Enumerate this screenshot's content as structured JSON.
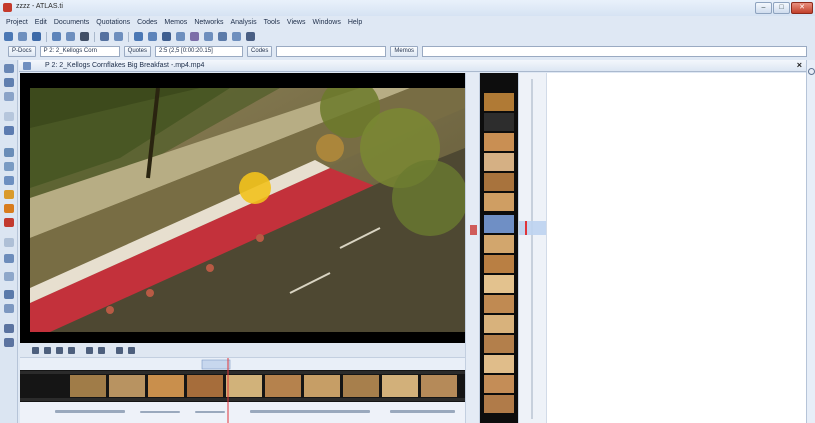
{
  "window": {
    "title": "zzzz - ATLAS.ti"
  },
  "menu": [
    "Project",
    "Edit",
    "Documents",
    "Quotations",
    "Codes",
    "Memos",
    "Networks",
    "Analysis",
    "Tools",
    "Views",
    "Windows",
    "Help"
  ],
  "docbar": {
    "docs_label": "P-Docs",
    "doc_value": "P 2: 2_Kellogs Corn",
    "quotes_label": "Quotes",
    "quote_value": "2:5 (2,5 [0:00:20.15]",
    "codes_label": "Codes",
    "memos_label": "Memos"
  },
  "document": {
    "title": "P 2: 2_Kellogs Cornflakes  Big Breakfast -.mp4.mp4"
  },
  "colors": {
    "accent": "#c43a2c",
    "chrome": "#dfe8f4",
    "playhead": "#e0343a"
  }
}
